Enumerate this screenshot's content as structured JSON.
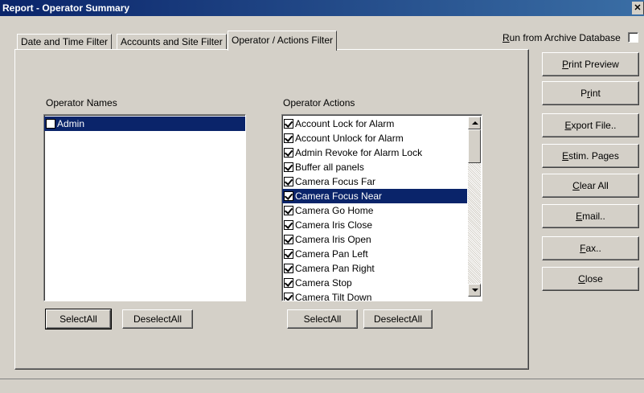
{
  "window": {
    "title": "Report  - Operator Summary",
    "close_glyph": "✕"
  },
  "tabs": [
    {
      "label": "Date and Time Filter"
    },
    {
      "label": "Accounts and Site Filter"
    },
    {
      "label": "Operator / Actions Filter"
    }
  ],
  "archive": {
    "label_prefix": "R",
    "label_rest": "un from Archive Database",
    "checked": false
  },
  "operator_names": {
    "label": "Operator Names",
    "items": [
      {
        "label": "Admin",
        "checked": false,
        "selected": true
      }
    ],
    "select_all": "SelectAll",
    "deselect_all": "DeselectAll"
  },
  "operator_actions": {
    "label": "Operator Actions",
    "items": [
      {
        "label": "Account Lock for Alarm",
        "checked": true,
        "selected": false
      },
      {
        "label": "Account Unlock for Alarm",
        "checked": true,
        "selected": false
      },
      {
        "label": "Admin Revoke for Alarm Lock",
        "checked": true,
        "selected": false
      },
      {
        "label": "Buffer all panels",
        "checked": true,
        "selected": false
      },
      {
        "label": "Camera Focus Far",
        "checked": true,
        "selected": false
      },
      {
        "label": "Camera Focus Near",
        "checked": true,
        "selected": true
      },
      {
        "label": "Camera Go Home",
        "checked": true,
        "selected": false
      },
      {
        "label": "Camera Iris Close",
        "checked": true,
        "selected": false
      },
      {
        "label": "Camera Iris Open",
        "checked": true,
        "selected": false
      },
      {
        "label": "Camera Pan Left",
        "checked": true,
        "selected": false
      },
      {
        "label": "Camera Pan Right",
        "checked": true,
        "selected": false
      },
      {
        "label": "Camera Stop",
        "checked": true,
        "selected": false
      },
      {
        "label": "Camera Tilt Down",
        "checked": true,
        "selected": false
      }
    ],
    "select_all": "SelectAll",
    "deselect_all": "DeselectAll"
  },
  "side_buttons": [
    {
      "name": "print-preview-button",
      "mn": "P",
      "rest": "rint Preview",
      "pre": ""
    },
    {
      "name": "print-button",
      "pre": "P",
      "mn": "r",
      "rest": "int"
    },
    {
      "name": "export-file-button",
      "pre": "",
      "mn": "E",
      "rest": "xport File.."
    },
    {
      "name": "estim-pages-button",
      "pre": "",
      "mn": "E",
      "rest": "stim. Pages"
    },
    {
      "name": "clear-all-button",
      "pre": "",
      "mn": "C",
      "rest": "lear All"
    },
    {
      "name": "email-button",
      "pre": "",
      "mn": "E",
      "rest": "mail.."
    },
    {
      "name": "fax-button",
      "pre": "",
      "mn": "F",
      "rest": "ax.."
    },
    {
      "name": "close-button",
      "pre": "",
      "mn": "C",
      "rest": "lose"
    }
  ],
  "colors": {
    "face": "#d4d0c8",
    "selection": "#0a246a",
    "titlebar": "#0a246a"
  }
}
